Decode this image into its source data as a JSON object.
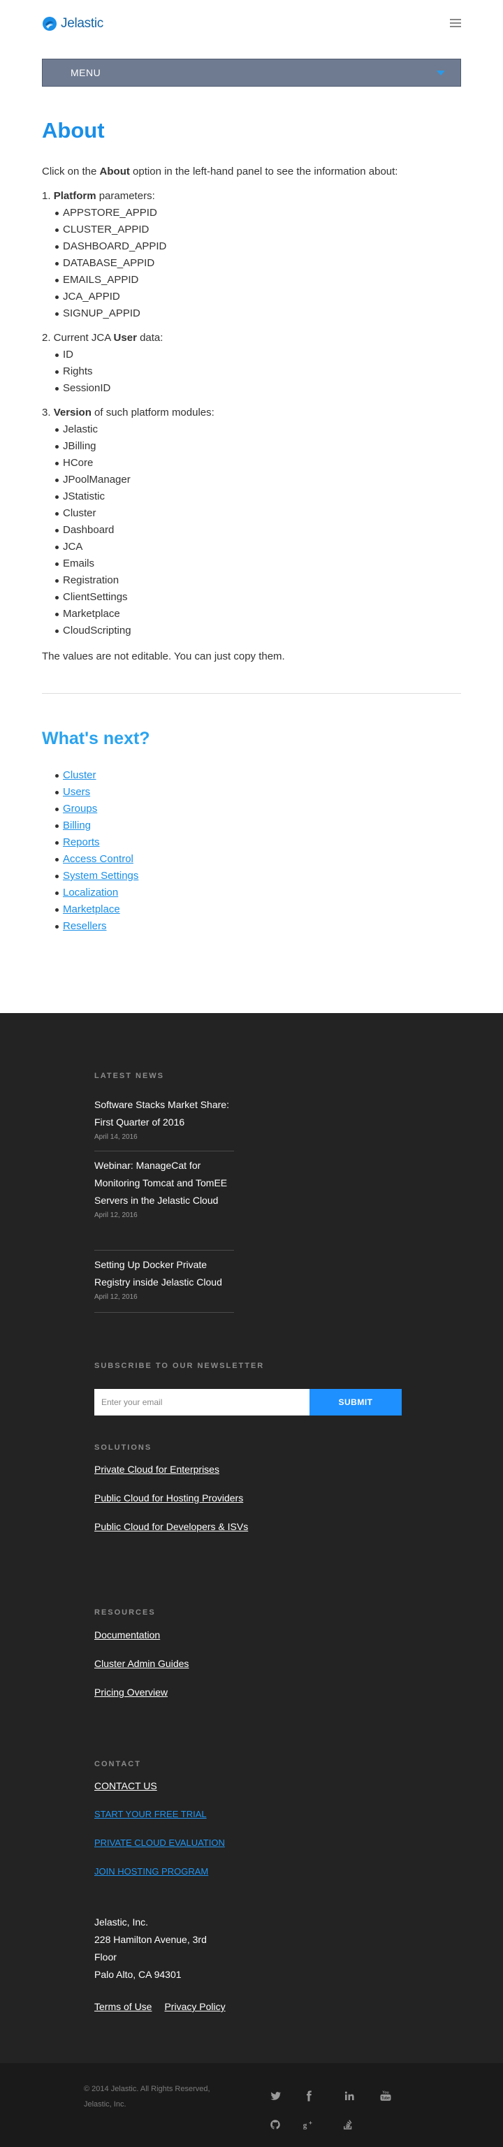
{
  "header": {
    "logo_text": "Jelastic",
    "menu_label": "MENU"
  },
  "about": {
    "title": "About",
    "intro_pre": "Click on the ",
    "intro_bold": "About",
    "intro_post": " option in the left-hand panel to see the information about:",
    "platform_prefix": "1. ",
    "platform_bold": "Platform",
    "platform_suffix": " parameters:",
    "platform_items": [
      "APPSTORE_APPID",
      "CLUSTER_APPID",
      "DASHBOARD_APPID",
      "DATABASE_APPID",
      "EMAILS_APPID",
      "JCA_APPID",
      "SIGNUP_APPID"
    ],
    "user_prefix": "2. Current JCA ",
    "user_bold": "User",
    "user_suffix": " data:",
    "user_items": [
      "ID",
      "Rights",
      "SessionID"
    ],
    "version_prefix": "3. ",
    "version_bold": "Version",
    "version_suffix": " of such platform modules:",
    "version_items": [
      "Jelastic",
      "JBilling",
      "HCore",
      "JPoolManager",
      "JStatistic",
      "Cluster",
      "Dashboard",
      "JCA",
      "Emails",
      "Registration",
      "ClientSettings",
      "Marketplace",
      "CloudScripting"
    ],
    "note": "The values are not editable. You can just copy them."
  },
  "whats_next": {
    "title": "What's next?",
    "links": [
      "Cluster",
      "Users",
      "Groups",
      "Billing",
      "Reports",
      "Access Control",
      "System Settings",
      "Localization",
      "Marketplace",
      "Resellers"
    ]
  },
  "footer": {
    "latest_news_heading": "LATEST NEWS",
    "news": [
      {
        "title": "Software Stacks Market Share: First Quarter of 2016",
        "date": "April 14, 2016"
      },
      {
        "title": "Webinar: ManageCat for Monitoring Tomcat and TomEE Servers in the Jelastic Cloud",
        "date": "April 12, 2016"
      },
      {
        "title": "Setting Up Docker Private Registry inside Jelastic Cloud",
        "date": "April 12, 2016"
      }
    ],
    "newsletter_heading": "SUBSCRIBE TO OUR NEWSLETTER",
    "newsletter_placeholder": "Enter your email",
    "newsletter_button": "SUBMIT",
    "solutions_heading": "SOLUTIONS",
    "solutions": [
      "Private Cloud for Enterprises",
      "Public Cloud for Hosting Providers",
      "Public Cloud for Developers & ISVs"
    ],
    "resources_heading": "RESOURCES",
    "resources": [
      "Documentation",
      "Cluster Admin Guides",
      "Pricing Overview"
    ],
    "contact_heading": "CONTACT",
    "contact_us": "CONTACT US",
    "contact_links": [
      "START YOUR FREE TRIAL",
      "PRIVATE CLOUD EVALUATION",
      "JOIN HOSTING PROGRAM"
    ],
    "address": [
      "Jelastic, Inc.",
      "228 Hamilton Avenue, 3rd",
      "Floor",
      "Palo Alto, CA 94301"
    ],
    "terms": "Terms of Use",
    "privacy": "Privacy Policy",
    "copyright_1": "© 2014 Jelastic. All Rights Reserved,",
    "copyright_2": "Jelastic, Inc.",
    "social_icons": [
      "twitter-icon",
      "facebook-icon",
      "linkedin-icon",
      "youtube-icon",
      "github-icon",
      "google-plus-icon",
      "stackoverflow-icon"
    ],
    "colors": {
      "background": "#232323",
      "bottom_bar": "#1a1a1a",
      "accent": "#1e90ff"
    }
  }
}
